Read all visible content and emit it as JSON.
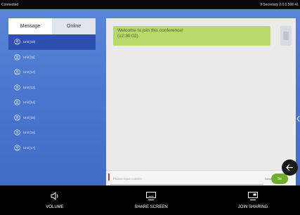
{
  "status_bar": {
    "left": "Connected",
    "right": "9 Secretary 2.0.0.508 41"
  },
  "tabs": [
    {
      "label": "Message",
      "active": true
    },
    {
      "label": "Online",
      "active": false
    }
  ],
  "units": [
    {
      "label": "Unit [10]",
      "selected": true
    },
    {
      "label": "Unit [11]",
      "selected": false
    },
    {
      "label": "Unit [12]",
      "selected": false
    },
    {
      "label": "Unit [13]",
      "selected": false
    },
    {
      "label": "Unit [14]",
      "selected": false
    },
    {
      "label": "Unit [15]",
      "selected": false
    },
    {
      "label": "Unit [16]",
      "selected": false
    },
    {
      "label": "Unit [17]",
      "selected": false
    }
  ],
  "chat": {
    "message_line1": "Welcome to join this conference!",
    "message_line2": "(12:30:02)"
  },
  "input": {
    "placeholder": "Please input content",
    "send_hint": "Send",
    "send_label": "Se"
  },
  "bottom_bar": {
    "volume_label": "VOLUME",
    "share_screen_label": "SHARE SCREEN",
    "join_sharing_label": "JOIN SHARING"
  },
  "colors": {
    "panel_blue": "#4b77d0",
    "selected_unit": "#2f4fae",
    "message_bubble": "#bad96a",
    "send_green": "#6fae2c"
  }
}
